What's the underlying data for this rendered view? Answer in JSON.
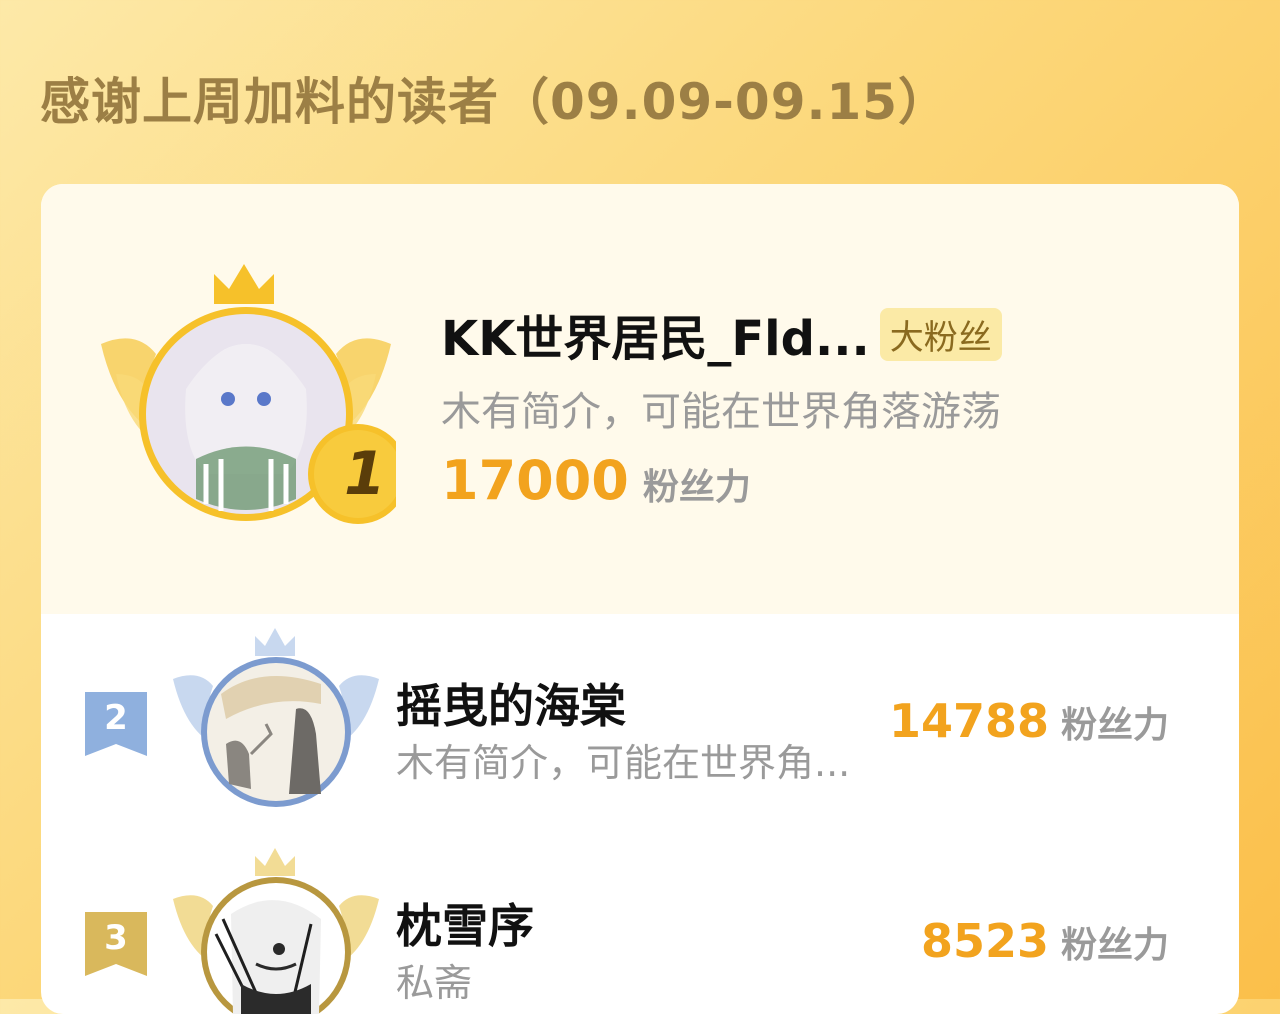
{
  "header": {
    "title": "感谢上周加料的读者（09.09-09.15）"
  },
  "leaderboard": [
    {
      "rank": "1",
      "name": "KK世界居民_Fld...",
      "badge": "大粉丝",
      "bio": "木有简介，可能在世界角落游荡",
      "score": "17000",
      "unit": "粉丝力",
      "rank_color": "#f6c12a"
    },
    {
      "rank": "2",
      "name": "摇曳的海棠",
      "bio": "木有简介，可能在世界角...",
      "score": "14788",
      "unit": "粉丝力",
      "rank_color": "#8fb0de"
    },
    {
      "rank": "3",
      "name": "枕雪序",
      "bio": "私斋",
      "score": "8523",
      "unit": "粉丝力",
      "rank_color": "#d9b85c"
    }
  ],
  "colors": {
    "accent": "#f2a31e",
    "title": "#9c7f45",
    "gold": "#f6c12a",
    "silver": "#8fb0de",
    "bronze": "#d9b85c"
  }
}
